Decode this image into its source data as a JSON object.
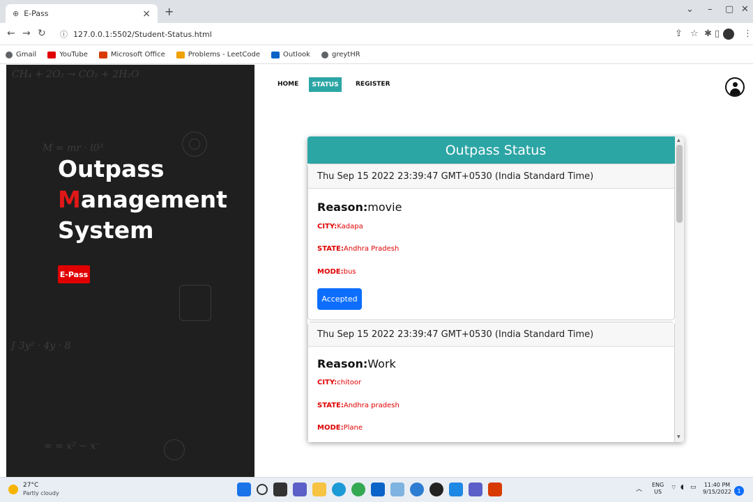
{
  "browser": {
    "tab_title": "E-Pass",
    "tab_close": "×",
    "new_tab": "+",
    "url": "127.0.0.1:5502/Student-Status.html",
    "bookmarks": [
      {
        "label": "Gmail",
        "color": "#5f6368"
      },
      {
        "label": "YouTube",
        "color": "#e00000"
      },
      {
        "label": "Microsoft Office",
        "color": "#d83b01"
      },
      {
        "label": "Problems - LeetCode",
        "color": "#f0a000"
      },
      {
        "label": "Outlook",
        "color": "#0a64c8"
      },
      {
        "label": "greytHR",
        "color": "#5f6368"
      }
    ]
  },
  "hero": {
    "title_line1": "Outpass",
    "title_line2_first": "M",
    "title_line2_rest": "anagement",
    "title_line3": "System",
    "badge": "E-Pass",
    "formula1": "CH₄ + 2O₂ → CO₂ + 2H₂O",
    "formula2": "M = mr · l0³",
    "formula3": "∫ 3y² · 4y · 8",
    "formula4": "∞ = x² − x⁻"
  },
  "nav": {
    "home": "HOME",
    "status": "STATUS",
    "register": "REGISTER"
  },
  "status": {
    "heading": "Outpass Status",
    "labels": {
      "reason": "Reason:",
      "city": "CITY:",
      "state": "STATE:",
      "mode": "MODE:"
    },
    "entries": [
      {
        "date": "Thu Sep 15 2022 23:39:47 GMT+0530 (India Standard Time)",
        "reason": "movie",
        "city": "Kadapa",
        "state": "Andhra Pradesh",
        "mode": "bus",
        "status": "Accepted"
      },
      {
        "date": "Thu Sep 15 2022 23:39:47 GMT+0530 (India Standard Time)",
        "reason": "Work",
        "city": "chitoor",
        "state": "Andhra pradesh",
        "mode": "Plane"
      }
    ]
  },
  "taskbar": {
    "temp": "27°C",
    "weather": "Partly cloudy",
    "lang_top": "ENG",
    "lang_bottom": "US",
    "time": "11:40 PM",
    "date": "9/15/2022",
    "notification_count": "1"
  },
  "colors": {
    "accent": "#2ca5a5",
    "danger": "#e00000",
    "primary": "#0d6efd"
  }
}
